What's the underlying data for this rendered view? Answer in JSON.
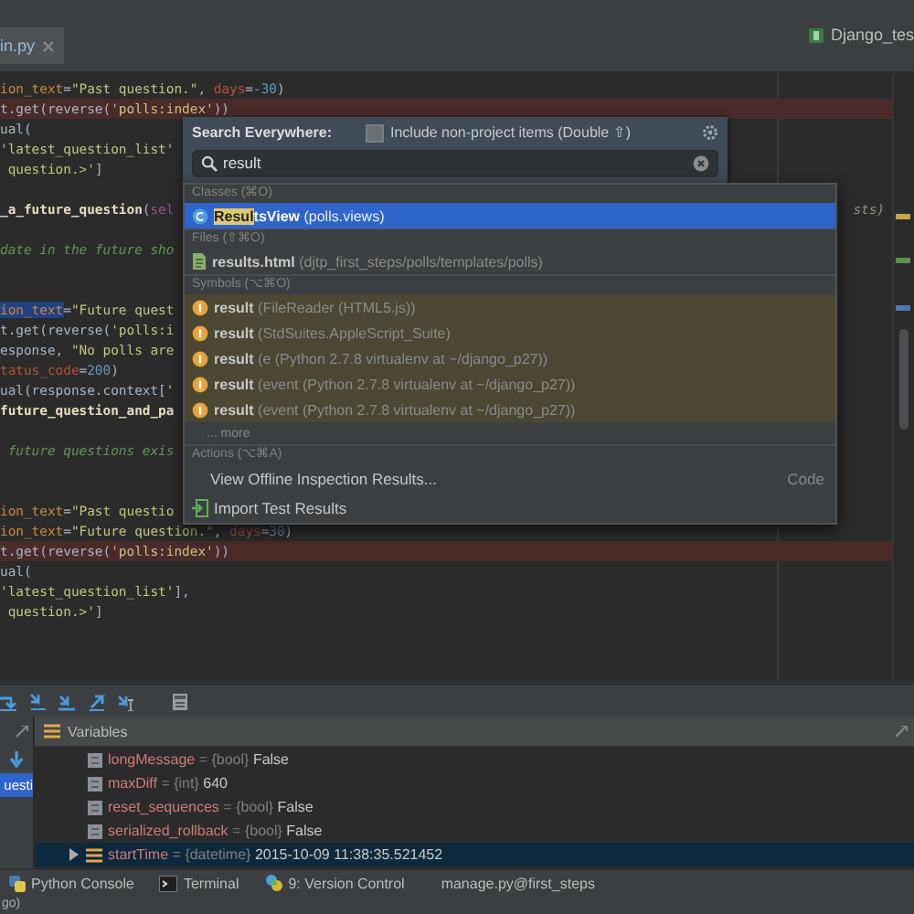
{
  "editor_tabs": [
    {
      "label": "in.py",
      "selected": true
    }
  ],
  "run_config": {
    "label": "Django_tes"
  },
  "code_lines": [
    {
      "kind": "code",
      "breakpoint": false,
      "segments": [
        {
          "kind": "name",
          "text": "ion_text"
        },
        {
          "kind": "plain",
          "text": "="
        },
        {
          "kind": "string",
          "text": "\"Past question.\""
        },
        {
          "kind": "plain",
          "text": ", "
        },
        {
          "kind": "kwarg",
          "text": "days"
        },
        {
          "kind": "plain",
          "text": "="
        },
        {
          "kind": "number",
          "text": "-30"
        },
        {
          "kind": "plain",
          "text": ")"
        }
      ]
    },
    {
      "kind": "code",
      "breakpoint": true,
      "segments": [
        {
          "kind": "plain",
          "text": "t.get(reverse("
        },
        {
          "kind": "string",
          "text": "'polls:index'"
        },
        {
          "kind": "plain",
          "text": "))"
        }
      ]
    },
    {
      "kind": "code",
      "breakpoint": false,
      "segments": [
        {
          "kind": "plain",
          "text": "ual("
        }
      ]
    },
    {
      "kind": "code",
      "breakpoint": false,
      "segments": [
        {
          "kind": "string",
          "text": "'latest_question_list'"
        }
      ]
    },
    {
      "kind": "code",
      "breakpoint": false,
      "segments": [
        {
          "kind": "string",
          "text": " question.>'"
        },
        {
          "kind": "plain",
          "text": "]"
        }
      ]
    },
    {
      "kind": "blank"
    },
    {
      "kind": "code",
      "breakpoint": false,
      "segments": [
        {
          "kind": "def",
          "text": "_a_future_question"
        },
        {
          "kind": "plain",
          "text": "("
        },
        {
          "kind": "self",
          "text": "sel"
        }
      ],
      "tail": "sts)"
    },
    {
      "kind": "blank"
    },
    {
      "kind": "code",
      "breakpoint": false,
      "segments": [
        {
          "kind": "comment",
          "text": "date in the future sho"
        }
      ]
    },
    {
      "kind": "blank"
    },
    {
      "kind": "blank"
    },
    {
      "kind": "code",
      "breakpoint": false,
      "segments": [
        {
          "kind": "selected",
          "text": "ion_text"
        },
        {
          "kind": "plain",
          "text": "="
        },
        {
          "kind": "string",
          "text": "\"Future quest"
        }
      ]
    },
    {
      "kind": "code",
      "breakpoint": false,
      "segments": [
        {
          "kind": "plain",
          "text": "t.get(reverse("
        },
        {
          "kind": "string",
          "text": "'polls:i"
        }
      ]
    },
    {
      "kind": "code",
      "breakpoint": false,
      "segments": [
        {
          "kind": "plain",
          "text": "esponse, "
        },
        {
          "kind": "string",
          "text": "\"No polls are"
        }
      ]
    },
    {
      "kind": "code",
      "breakpoint": false,
      "segments": [
        {
          "kind": "kwarg",
          "text": "tatus_code"
        },
        {
          "kind": "plain",
          "text": "="
        },
        {
          "kind": "number",
          "text": "200"
        },
        {
          "kind": "plain",
          "text": ")"
        }
      ]
    },
    {
      "kind": "code",
      "breakpoint": false,
      "segments": [
        {
          "kind": "plain",
          "text": "ual(response.context["
        },
        {
          "kind": "string",
          "text": "'"
        }
      ]
    },
    {
      "kind": "code",
      "breakpoint": false,
      "segments": [
        {
          "kind": "def",
          "text": "future_question_and_pa"
        }
      ]
    },
    {
      "kind": "blank"
    },
    {
      "kind": "code",
      "breakpoint": false,
      "segments": [
        {
          "kind": "comment",
          "text": " future questions exis"
        }
      ]
    },
    {
      "kind": "blank"
    },
    {
      "kind": "blank"
    },
    {
      "kind": "code",
      "breakpoint": false,
      "segments": [
        {
          "kind": "name",
          "text": "ion_text"
        },
        {
          "kind": "plain",
          "text": "="
        },
        {
          "kind": "string",
          "text": "\"Past questio"
        }
      ]
    },
    {
      "kind": "code",
      "breakpoint": false,
      "segments": [
        {
          "kind": "name",
          "text": "ion_text"
        },
        {
          "kind": "plain",
          "text": "="
        },
        {
          "kind": "string",
          "text": "\"Future question.\""
        },
        {
          "kind": "plain",
          "text": ", "
        },
        {
          "kind": "kwarg",
          "text": "days"
        },
        {
          "kind": "plain",
          "text": "="
        },
        {
          "kind": "number",
          "text": "30"
        },
        {
          "kind": "plain",
          "text": ")"
        }
      ]
    },
    {
      "kind": "code",
      "breakpoint": true,
      "segments": [
        {
          "kind": "plain",
          "text": "t.get(reverse("
        },
        {
          "kind": "string",
          "text": "'polls:index'"
        },
        {
          "kind": "plain",
          "text": "))"
        }
      ]
    },
    {
      "kind": "code",
      "breakpoint": false,
      "segments": [
        {
          "kind": "plain",
          "text": "ual("
        }
      ]
    },
    {
      "kind": "code",
      "breakpoint": false,
      "segments": [
        {
          "kind": "string",
          "text": "'latest_question_list'"
        },
        {
          "kind": "plain",
          "text": "],"
        }
      ]
    },
    {
      "kind": "code",
      "breakpoint": false,
      "segments": [
        {
          "kind": "string",
          "text": " question.>'"
        },
        {
          "kind": "plain",
          "text": "]"
        }
      ]
    }
  ],
  "search_popup": {
    "title": "Search Everywhere:",
    "include_option": {
      "label": "Include non-project items (Double ⇧)",
      "checked": false
    },
    "query": "result",
    "sections": [
      {
        "heading": "Classes (⌘O)",
        "items": [
          {
            "kind": "class",
            "match": "Resul",
            "name": "tsView",
            "detail": "(polls.views)",
            "selected": true
          }
        ]
      },
      {
        "heading": "Files (⇧⌘O)",
        "items": [
          {
            "kind": "file",
            "name": "results.html",
            "detail": "(djtp_first_steps/polls/templates/polls)",
            "selected": false
          }
        ]
      },
      {
        "heading": "Symbols (⌥⌘O)",
        "items": [
          {
            "kind": "symbol",
            "name": "result",
            "detail": "(FileReader (HTML5.js))",
            "selected": false
          },
          {
            "kind": "symbol",
            "name": "result",
            "detail": "(StdSuites.AppleScript_Suite)",
            "selected": false
          },
          {
            "kind": "symbol",
            "name": "result",
            "detail": "(e (Python 2.7.8 virtualenv at ~/django_p27))",
            "selected": false
          },
          {
            "kind": "symbol",
            "name": "result",
            "detail": "(event (Python 2.7.8 virtualenv at ~/django_p27))",
            "selected": false
          },
          {
            "kind": "symbol",
            "name": "result",
            "detail": "(event (Python 2.7.8 virtualenv at ~/django_p27))",
            "selected": false
          },
          {
            "kind": "more",
            "name": "... more",
            "selected": false
          }
        ]
      },
      {
        "heading": "Actions (⌥⌘A)",
        "items": [
          {
            "kind": "action",
            "name": "View Offline Inspection Results...",
            "detail": "Code",
            "selected": false
          },
          {
            "kind": "import",
            "name": "Import Test Results",
            "selected": false
          }
        ]
      }
    ]
  },
  "frames": [
    {
      "label": "uesti",
      "selected": true
    }
  ],
  "variables_panel": {
    "title": "Variables",
    "variables": [
      {
        "kind": "field",
        "name": "longMessage",
        "separator": "=",
        "type": "{bool}",
        "value": "False",
        "selected": false
      },
      {
        "kind": "field",
        "name": "maxDiff",
        "separator": "=",
        "type": "{int}",
        "value": "640",
        "selected": false
      },
      {
        "kind": "field",
        "name": "reset_sequences",
        "separator": "=",
        "type": "{bool}",
        "value": "False",
        "selected": false
      },
      {
        "kind": "field",
        "name": "serialized_rollback",
        "separator": "=",
        "type": "{bool}",
        "value": "False",
        "selected": false
      },
      {
        "kind": "object",
        "name": "startTime",
        "separator": "=",
        "type": "{datetime}",
        "value": "2015-10-09 11:38:35.521452",
        "selected": true,
        "expanded": false
      }
    ]
  },
  "tool_windows": [
    {
      "kind": "python",
      "label": "Python Console"
    },
    {
      "kind": "terminal",
      "label": "Terminal"
    },
    {
      "kind": "vcs",
      "label": "9: Version Control"
    },
    {
      "kind": "text",
      "label": "manage.py@first_steps"
    }
  ],
  "status_text": "go)"
}
